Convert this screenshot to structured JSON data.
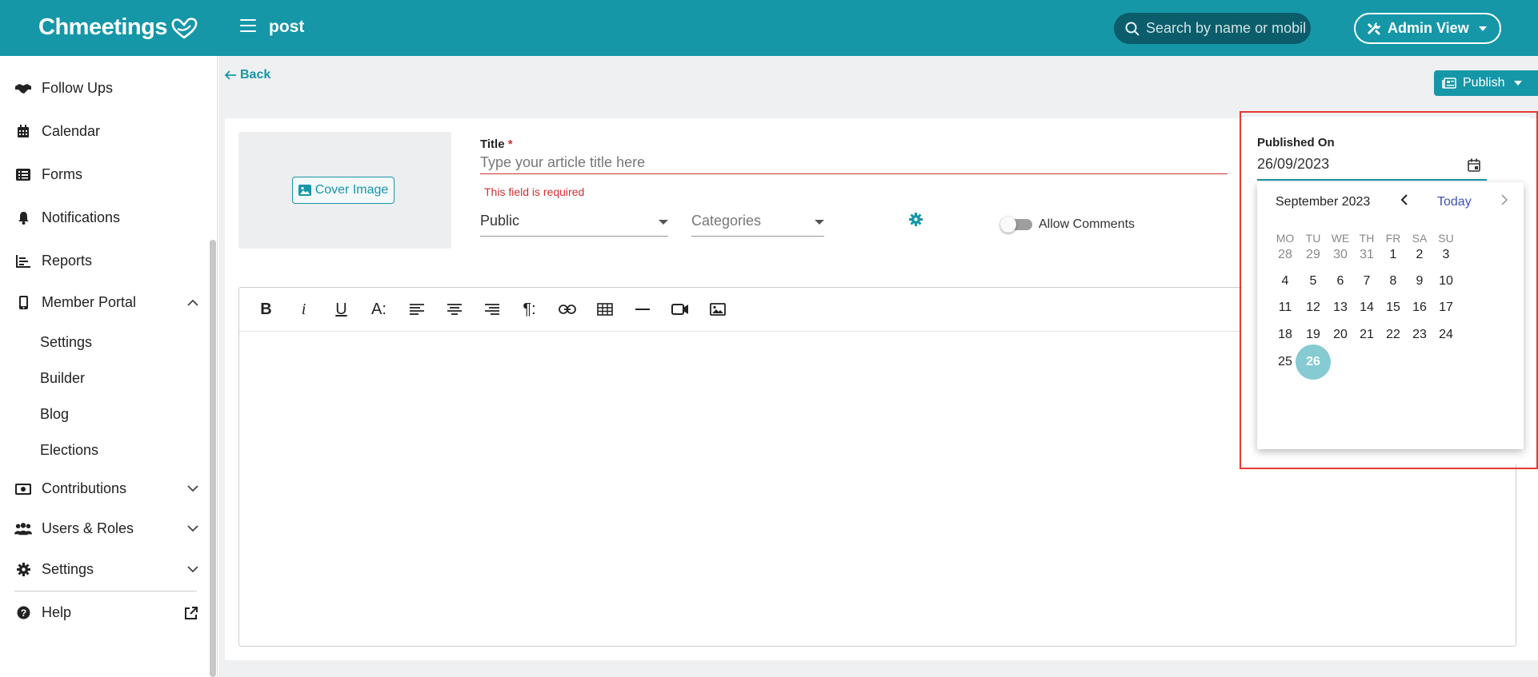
{
  "topbar": {
    "logo": "Chmeetings",
    "page_title": "post",
    "search_placeholder": "Search by name or mobile",
    "admin_label": "Admin View"
  },
  "sidebar": {
    "items": [
      {
        "label": "Follow Ups",
        "icon": "handshake-icon"
      },
      {
        "label": "Calendar",
        "icon": "calendar-icon"
      },
      {
        "label": "Forms",
        "icon": "list-icon"
      },
      {
        "label": "Notifications",
        "icon": "bell-icon"
      },
      {
        "label": "Reports",
        "icon": "chart-icon"
      },
      {
        "label": "Member Portal",
        "icon": "mobile-icon"
      },
      {
        "label": "Contributions",
        "icon": "money-icon"
      },
      {
        "label": "Users & Roles",
        "icon": "users-icon"
      },
      {
        "label": "Settings",
        "icon": "gear-icon"
      },
      {
        "label": "Help",
        "icon": "help-icon"
      }
    ],
    "member_portal_sub": [
      "Settings",
      "Builder",
      "Blog",
      "Elections"
    ]
  },
  "main": {
    "back_label": "Back",
    "publish_label": "Publish",
    "cover_label": "Cover Image",
    "title_label": "Title",
    "title_required": "*",
    "title_placeholder": "Type your article title here",
    "title_error": "This field is required",
    "visibility_value": "Public",
    "categories_placeholder": "Categories",
    "allow_comments_label": "Allow Comments",
    "allow_comments_on": false
  },
  "datepicker": {
    "label": "Published On",
    "value": "26/09/2023",
    "month_label": "September 2023",
    "today_label": "Today",
    "weekdays": [
      "MO",
      "TU",
      "WE",
      "TH",
      "FR",
      "SA",
      "SU"
    ],
    "weeks": [
      [
        "28",
        "29",
        "30",
        "31",
        "1",
        "2",
        "3"
      ],
      [
        "4",
        "5",
        "6",
        "7",
        "8",
        "9",
        "10"
      ],
      [
        "11",
        "12",
        "13",
        "14",
        "15",
        "16",
        "17"
      ],
      [
        "18",
        "19",
        "20",
        "21",
        "22",
        "23",
        "24"
      ],
      [
        "25",
        "26"
      ]
    ],
    "muted_count": 4,
    "selected": "26"
  },
  "colors": {
    "brand": "#1597a8",
    "error": "#d32f2f",
    "selected_day": "#86cad2",
    "today_link": "#3f51b5"
  }
}
